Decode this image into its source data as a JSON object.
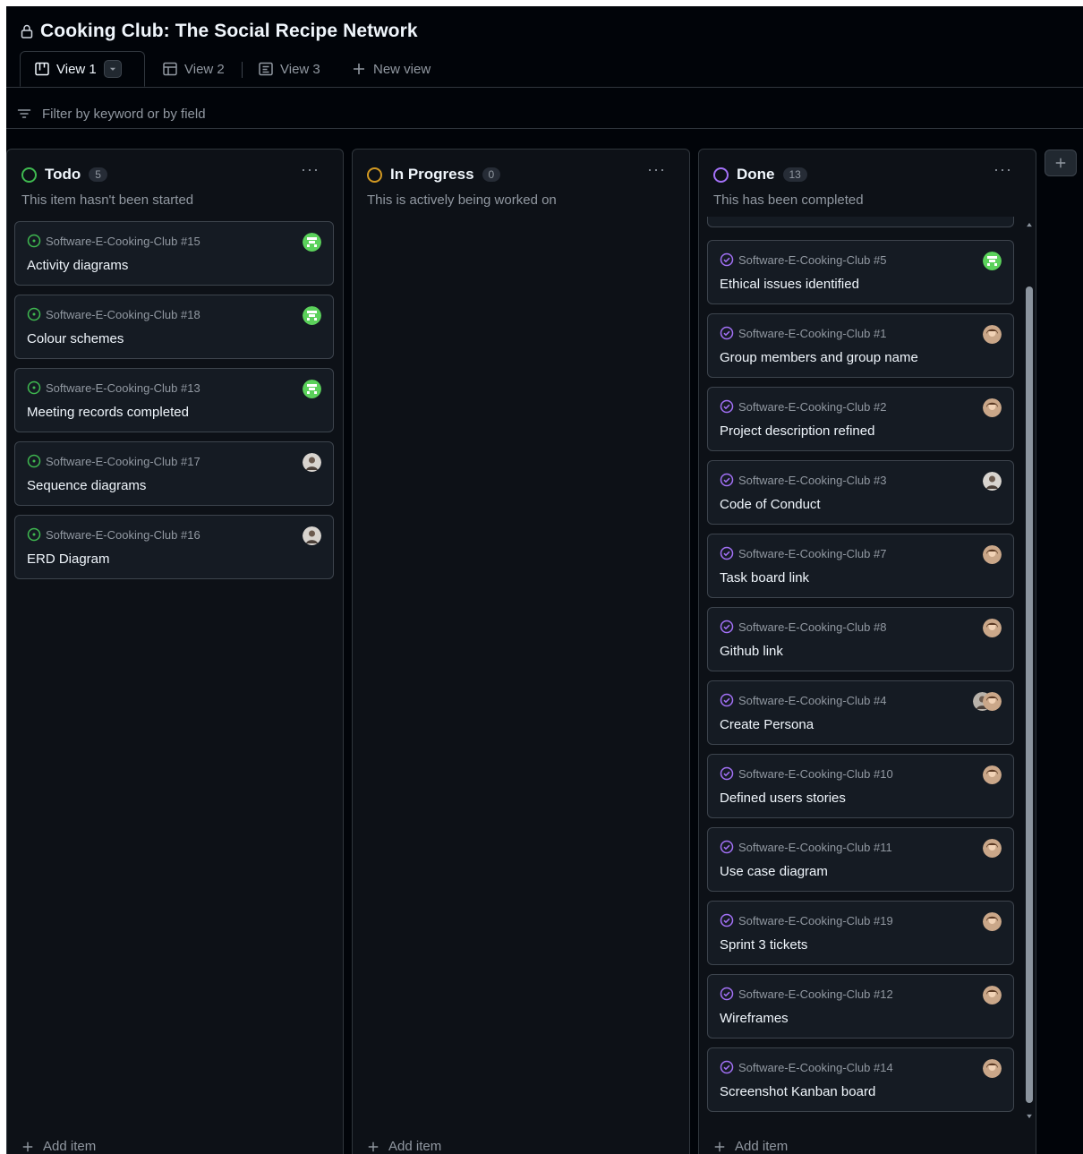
{
  "project": {
    "title": "Cooking Club: The Social Recipe Network"
  },
  "tabs": [
    {
      "label": "View 1",
      "icon": "board-icon",
      "active": true
    },
    {
      "label": "View 2",
      "icon": "table-icon",
      "active": false
    },
    {
      "label": "View 3",
      "icon": "roadmap-icon",
      "active": false
    },
    {
      "label": "New view",
      "icon": "plus-icon",
      "active": false
    }
  ],
  "filter": {
    "placeholder": "Filter by keyword or by field"
  },
  "columns": [
    {
      "name": "Todo",
      "count": "5",
      "color": "#3fb950",
      "description": "This item hasn't been started",
      "add_label": "Add item",
      "cards": [
        {
          "ref": "Software-E-Cooking-Club #15",
          "title": "Activity diagrams",
          "avatar": "green"
        },
        {
          "ref": "Software-E-Cooking-Club #18",
          "title": "Colour schemes",
          "avatar": "green"
        },
        {
          "ref": "Software-E-Cooking-Club #13",
          "title": "Meeting records completed",
          "avatar": "green"
        },
        {
          "ref": "Software-E-Cooking-Club #17",
          "title": "Sequence diagrams",
          "avatar": "photo2"
        },
        {
          "ref": "Software-E-Cooking-Club #16",
          "title": "ERD Diagram",
          "avatar": "photo2"
        }
      ]
    },
    {
      "name": "In Progress",
      "count": "0",
      "color": "#d29922",
      "description": "This is actively being worked on",
      "add_label": "Add item",
      "cards": []
    },
    {
      "name": "Done",
      "count": "13",
      "color": "#a371f7",
      "description": "This has been completed",
      "add_label": "Add item",
      "cards": [
        {
          "ref": "Software-E-Cooking-Club #5",
          "title": "Ethical issues identified",
          "avatar": "green"
        },
        {
          "ref": "Software-E-Cooking-Club #1",
          "title": "Group members and group name",
          "avatar": "photo1"
        },
        {
          "ref": "Software-E-Cooking-Club #2",
          "title": "Project description refined",
          "avatar": "photo1"
        },
        {
          "ref": "Software-E-Cooking-Club #3",
          "title": "Code of Conduct",
          "avatar": "photo2"
        },
        {
          "ref": "Software-E-Cooking-Club #7",
          "title": "Task board link",
          "avatar": "photo1"
        },
        {
          "ref": "Software-E-Cooking-Club #8",
          "title": "Github link",
          "avatar": "photo1"
        },
        {
          "ref": "Software-E-Cooking-Club #4",
          "title": "Create Persona",
          "avatar": "multi"
        },
        {
          "ref": "Software-E-Cooking-Club #10",
          "title": "Defined users stories",
          "avatar": "photo1"
        },
        {
          "ref": "Software-E-Cooking-Club #11",
          "title": "Use case diagram",
          "avatar": "photo1"
        },
        {
          "ref": "Software-E-Cooking-Club #19",
          "title": "Sprint 3 tickets",
          "avatar": "photo1"
        },
        {
          "ref": "Software-E-Cooking-Club #12",
          "title": "Wireframes",
          "avatar": "photo1"
        },
        {
          "ref": "Software-E-Cooking-Club #14",
          "title": "Screenshot Kanban board",
          "avatar": "photo1"
        }
      ]
    }
  ]
}
